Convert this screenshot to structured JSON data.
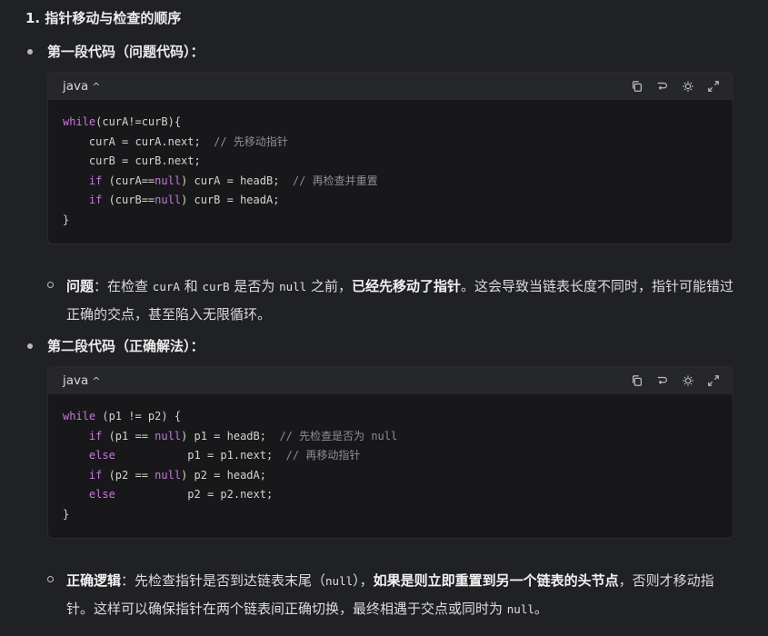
{
  "heading": "1. 指针移动与检查的顺序",
  "section1": {
    "label": "第一段代码（问题代码）：",
    "lang": "java",
    "code": [
      [
        [
          "kw",
          "while"
        ],
        [
          "t",
          "(curA!=curB){"
        ]
      ],
      [
        [
          "t",
          "    curA = curA.next;  "
        ],
        [
          "cm",
          "// 先移动指针"
        ]
      ],
      [
        [
          "t",
          "    curB = curB.next;"
        ]
      ],
      [
        [
          "t",
          "    "
        ],
        [
          "kw",
          "if"
        ],
        [
          "t",
          " (curA=="
        ],
        [
          "kw",
          "null"
        ],
        [
          "t",
          ") curA = headB;  "
        ],
        [
          "cm",
          "// 再检查并重置"
        ]
      ],
      [
        [
          "t",
          "    "
        ],
        [
          "kw",
          "if"
        ],
        [
          "t",
          " (curB=="
        ],
        [
          "kw",
          "null"
        ],
        [
          "t",
          ") curB = headA;"
        ]
      ],
      [
        [
          "t",
          "}"
        ]
      ]
    ],
    "note": {
      "label": "问题",
      "colon": "：在检查 ",
      "code1": "curA",
      "and": " 和 ",
      "code2": "curB",
      "mid": " 是否为 ",
      "code3": "null",
      "before": " 之前，",
      "bold": "已经先移动了指针",
      "after": "。这会导致当链表长度不同时，指针可能错过正确的交点，甚至陷入无限循环。"
    }
  },
  "section2": {
    "label": "第二段代码（正确解法）：",
    "lang": "java",
    "code": [
      [
        [
          "kw",
          "while"
        ],
        [
          "t",
          " (p1 != p2) {"
        ]
      ],
      [
        [
          "t",
          "    "
        ],
        [
          "kw",
          "if"
        ],
        [
          "t",
          " (p1 == "
        ],
        [
          "kw",
          "null"
        ],
        [
          "t",
          ") p1 = headB;  "
        ],
        [
          "cm",
          "// 先检查是否为 null"
        ]
      ],
      [
        [
          "t",
          "    "
        ],
        [
          "kw",
          "else"
        ],
        [
          "t",
          "           p1 = p1.next;  "
        ],
        [
          "cm",
          "// 再移动指针"
        ]
      ],
      [
        [
          "t",
          "    "
        ],
        [
          "kw",
          "if"
        ],
        [
          "t",
          " (p2 == "
        ],
        [
          "kw",
          "null"
        ],
        [
          "t",
          ") p2 = headA;"
        ]
      ],
      [
        [
          "t",
          "    "
        ],
        [
          "kw",
          "else"
        ],
        [
          "t",
          "           p2 = p2.next;"
        ]
      ],
      [
        [
          "t",
          "}"
        ]
      ]
    ],
    "note": {
      "label": "正确逻辑",
      "colon": "：先检查指针是否到达链表末尾（",
      "code1": "null",
      "mid": "），",
      "bold": "如果是则立即重置到另一个链表的头节点",
      "after": "，否则才移动指针。这样可以确保指针在两个链表间正确切换，最终相遇于交点或同时为 ",
      "code2": "null",
      "end": "。"
    }
  },
  "icons": [
    "copy-icon",
    "wrap-icon",
    "theme-icon",
    "expand-icon"
  ]
}
